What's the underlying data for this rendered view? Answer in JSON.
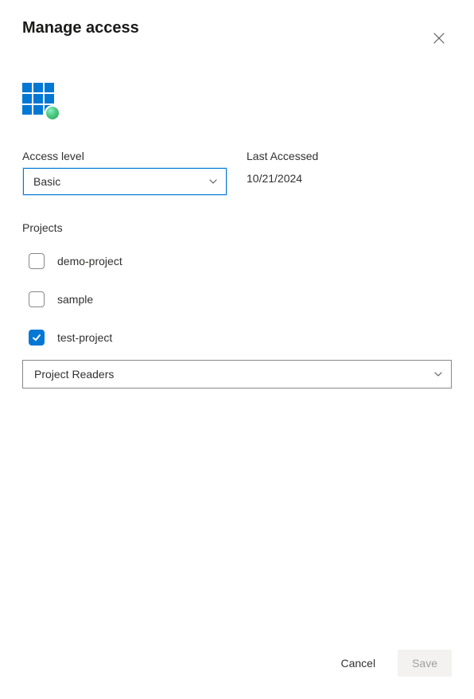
{
  "dialog": {
    "title": "Manage access"
  },
  "fields": {
    "access_level": {
      "label": "Access level",
      "value": "Basic"
    },
    "last_accessed": {
      "label": "Last Accessed",
      "value": "10/21/2024"
    }
  },
  "projects": {
    "label": "Projects",
    "items": [
      {
        "name": "demo-project",
        "checked": false
      },
      {
        "name": "sample",
        "checked": false
      },
      {
        "name": "test-project",
        "checked": true
      }
    ],
    "role_value": "Project Readers"
  },
  "actions": {
    "cancel": "Cancel",
    "save": "Save"
  }
}
